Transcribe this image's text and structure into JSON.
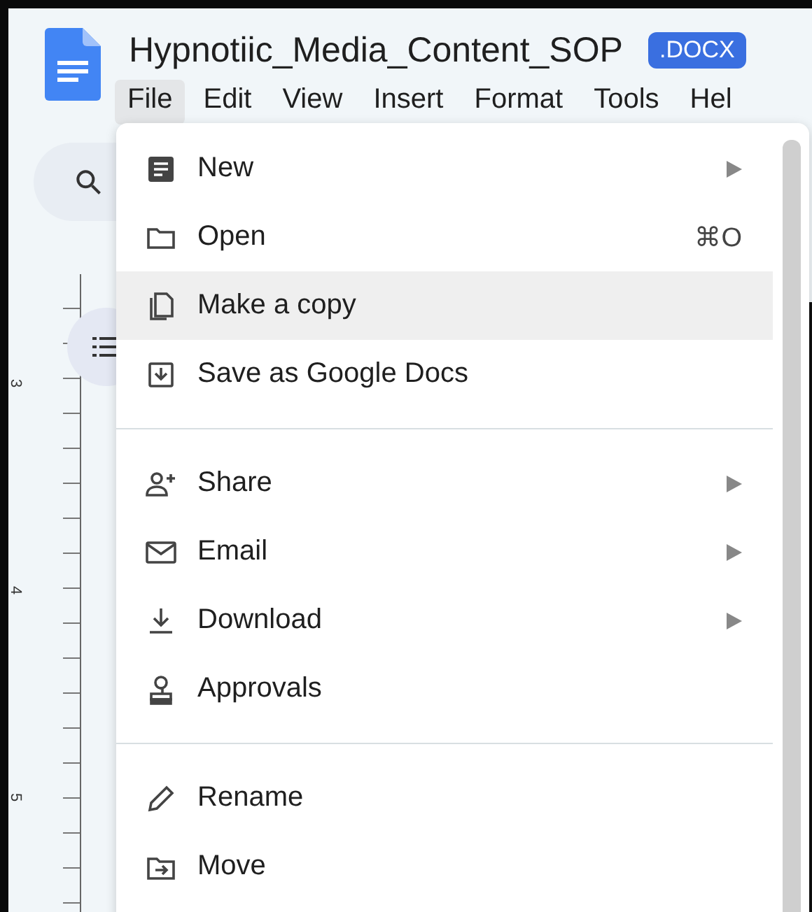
{
  "document": {
    "title": "Hypnotiic_Media_Content_SOP",
    "badge": ".DOCX"
  },
  "menu_bar": [
    {
      "label": "File",
      "selected": true
    },
    {
      "label": "Edit",
      "selected": false
    },
    {
      "label": "View",
      "selected": false
    },
    {
      "label": "Insert",
      "selected": false
    },
    {
      "label": "Format",
      "selected": false
    },
    {
      "label": "Tools",
      "selected": false
    },
    {
      "label": "Hel",
      "selected": false
    }
  ],
  "ruler": {
    "labels": [
      "3",
      "4",
      "5"
    ]
  },
  "file_menu": {
    "groups": [
      [
        {
          "label": "New",
          "submenu": true,
          "selected": false
        },
        {
          "label": "Open",
          "shortcut": "⌘O",
          "submenu": false,
          "selected": false
        },
        {
          "label": "Make a copy",
          "submenu": false,
          "selected": true
        },
        {
          "label": "Save as Google Docs",
          "submenu": false,
          "selected": false
        }
      ],
      [
        {
          "label": "Share",
          "submenu": true,
          "selected": false
        },
        {
          "label": "Email",
          "submenu": true,
          "selected": false
        },
        {
          "label": "Download",
          "submenu": true,
          "selected": false
        },
        {
          "label": "Approvals",
          "submenu": false,
          "selected": false
        }
      ],
      [
        {
          "label": "Rename",
          "submenu": false,
          "selected": false
        },
        {
          "label": "Move",
          "submenu": false,
          "selected": false
        }
      ]
    ]
  }
}
